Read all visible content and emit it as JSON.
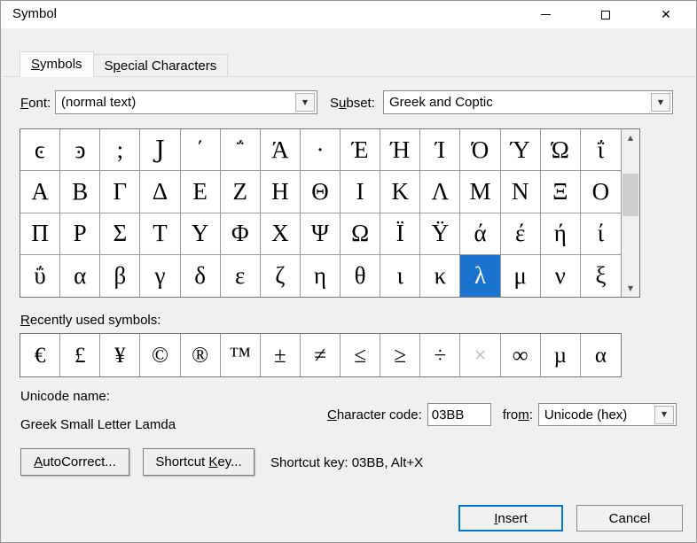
{
  "colors": {
    "dialog_bg": "#f0f0f0",
    "titlebar_bg": "#ffffff",
    "selection_bg": "#1a73cf",
    "default_button_border": "#0078d7"
  },
  "window": {
    "title": "Symbol"
  },
  "icons": {
    "close": "✕",
    "dropdown": "▼",
    "scroll_up": "▲",
    "scroll_down": "▼"
  },
  "tabs": {
    "symbols": {
      "pre": "",
      "mn": "S",
      "post": "ymbols"
    },
    "special_characters": {
      "pre": "S",
      "mn": "p",
      "post": "ecial Characters"
    }
  },
  "font_row": {
    "font_label": {
      "pre": "",
      "mn": "F",
      "post": "ont:"
    },
    "font_value": "(normal text)",
    "subset_label": {
      "pre": "S",
      "mn": "u",
      "post": "bset:"
    },
    "subset_value": "Greek and Coptic"
  },
  "symbol_grid": {
    "rows": [
      [
        "ͼ",
        "ͽ",
        ";",
        "Ϳ",
        "΄",
        "΅",
        "Ά",
        "·",
        "Έ",
        "Ή",
        "Ί",
        "Ό",
        "Ύ",
        "Ώ",
        "ΐ"
      ],
      [
        "Α",
        "Β",
        "Γ",
        "Δ",
        "Ε",
        "Ζ",
        "Η",
        "Θ",
        "Ι",
        "Κ",
        "Λ",
        "Μ",
        "Ν",
        "Ξ",
        "Ο"
      ],
      [
        "Π",
        "Ρ",
        "Σ",
        "Τ",
        "Υ",
        "Φ",
        "Χ",
        "Ψ",
        "Ω",
        "Ϊ",
        "Ϋ",
        "ά",
        "έ",
        "ή",
        "ί"
      ],
      [
        "ΰ",
        "α",
        "β",
        "γ",
        "δ",
        "ε",
        "ζ",
        "η",
        "θ",
        "ι",
        "κ",
        "λ",
        "μ",
        "ν",
        "ξ"
      ]
    ],
    "selected": {
      "row": 3,
      "col": 11,
      "char": "λ"
    }
  },
  "recent": {
    "label": {
      "pre": "",
      "mn": "R",
      "post": "ecently used symbols:"
    },
    "items": [
      "€",
      "£",
      "¥",
      "©",
      "®",
      "™",
      "±",
      "≠",
      "≤",
      "≥",
      "÷",
      "×",
      "∞",
      "µ",
      "α"
    ],
    "muted_indices": [
      11
    ]
  },
  "details": {
    "unicode_name_label": "Unicode name:",
    "unicode_name": "Greek Small Letter Lamda",
    "char_code_label": {
      "pre": "",
      "mn": "C",
      "post": "haracter code:"
    },
    "char_code_value": "03BB",
    "from_label": {
      "pre": "fro",
      "mn": "m",
      "post": ":"
    },
    "from_value": "Unicode (hex)"
  },
  "actions": {
    "autocorrect": {
      "pre": "",
      "mn": "A",
      "post": "utoCorrect..."
    },
    "shortcut_key": {
      "pre": "Shortcut ",
      "mn": "K",
      "post": "ey..."
    },
    "shortcut_hint": "Shortcut key: 03BB, Alt+X",
    "insert": {
      "pre": "",
      "mn": "I",
      "post": "nsert"
    },
    "cancel": "Cancel"
  }
}
